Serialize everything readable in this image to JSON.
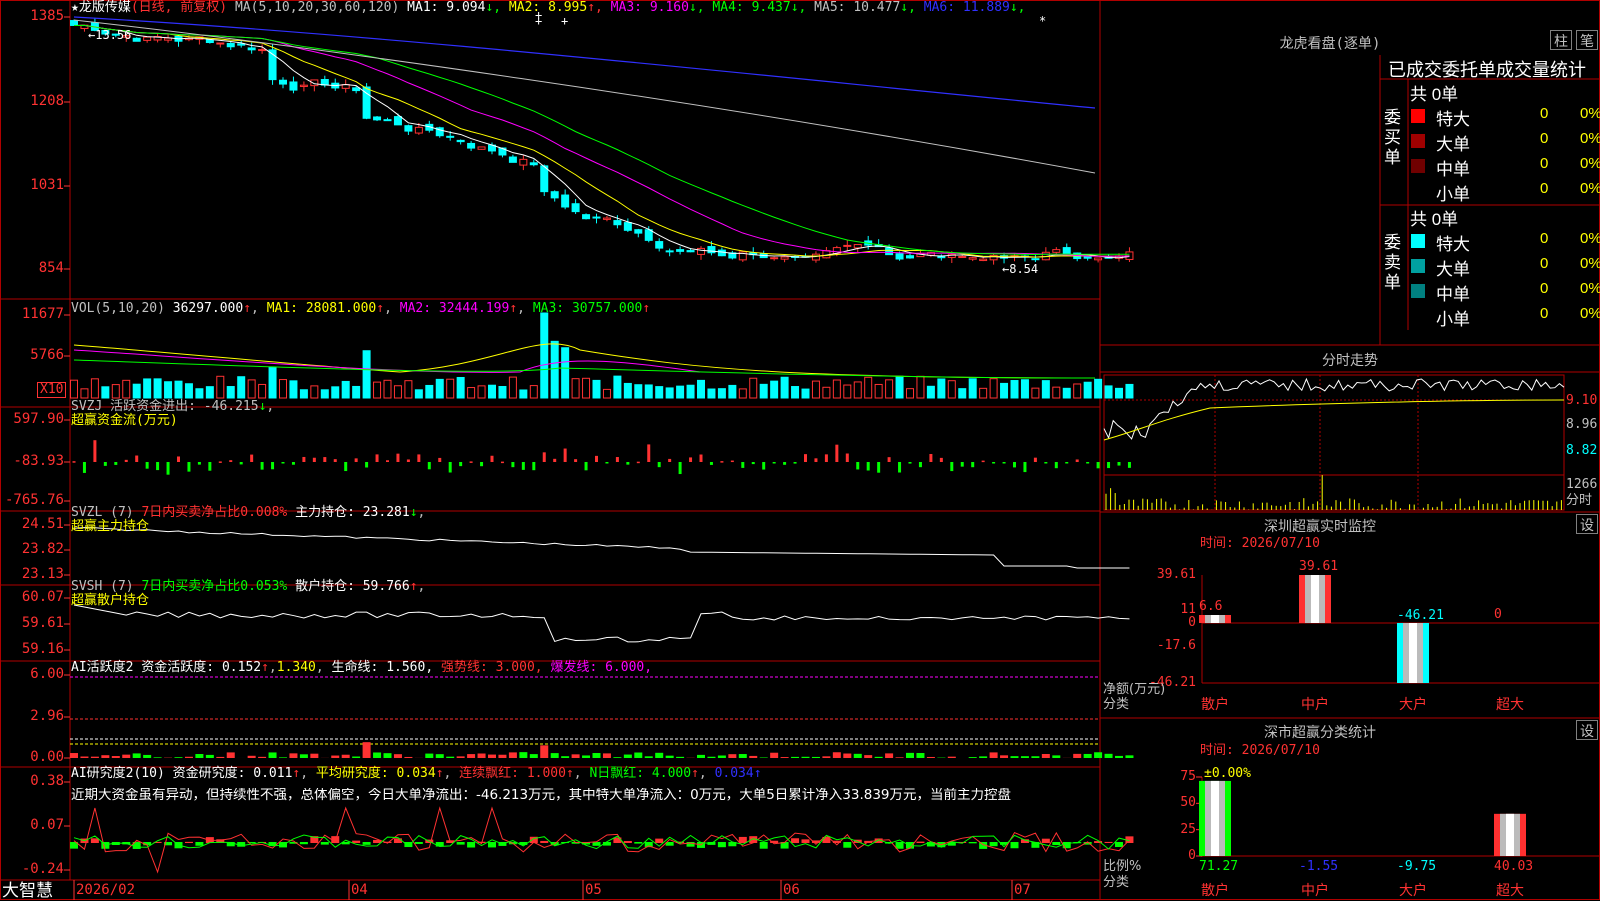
{
  "main": {
    "title": "★龙版传媒",
    "period": "(日线, 前复权)",
    "ma_label": "MA(5,10,20,30,60,120)",
    "ma": [
      {
        "label": "MA1:",
        "value": "9.094",
        "arrow": "↓",
        "color": "#ffffff"
      },
      {
        "label": "MA2:",
        "value": "8.995",
        "arrow": "↑",
        "color": "#ffff00"
      },
      {
        "label": "MA3:",
        "value": "9.160",
        "arrow": "↓",
        "color": "#ff00ff"
      },
      {
        "label": "MA4:",
        "value": "9.437",
        "arrow": "↓",
        "color": "#00ff00"
      },
      {
        "label": "MA5:",
        "value": "10.477",
        "arrow": "↓",
        "color": "#c0c0c0"
      },
      {
        "label": "MA6:",
        "value": "11.889",
        "arrow": "↓",
        "color": "#3030ff"
      }
    ],
    "y_ticks": [
      "1385",
      "1208",
      "1031",
      "854"
    ],
    "high_label": "13.56",
    "low_label": "8.54"
  },
  "vol": {
    "label": "VOL(5,10,20)",
    "value": "36297.000",
    "ma1": "MA1: 28081.000",
    "ma2": "MA2: 32444.199",
    "ma3": "MA3: 30757.000",
    "y_ticks": [
      "11677",
      "5766"
    ],
    "unit": "X10"
  },
  "svzj": {
    "label": "SVZJ  活跃资金进出: -46.215",
    "sub": "超赢资金流(万元)",
    "y_ticks": [
      "597.90",
      "-83.93",
      "-765.76"
    ]
  },
  "svzl": {
    "label": "SVZL (7)",
    "ratio": "7日内买卖净占比0.008%",
    "hold": "主力持仓: 23.281",
    "sub": "超赢主力持仓",
    "y_ticks": [
      "24.51",
      "23.82",
      "23.13"
    ]
  },
  "svsh": {
    "label": "SVSH (7)",
    "ratio": "7日内买卖净占比0.053%",
    "hold": "散户持仓: 59.766",
    "sub": "超赢散户持仓",
    "y_ticks": [
      "60.07",
      "59.61",
      "59.16"
    ]
  },
  "ai1": {
    "label": "AI活跃度2 资金活跃度: 0.152",
    "v2": "1.340",
    "life": "生命线: 1.560,",
    "strong": "强势线: 3.000,",
    "burst": "爆发线: 6.000,",
    "y_ticks": [
      "6.00",
      "2.96",
      "0.00"
    ]
  },
  "ai2": {
    "label": "AI研究度2(10) 资金研究度: 0.011",
    "avg": "平均研究度: 0.034",
    "cont": "连续飘红: 1.000",
    "nday": "N日飘红: 4.000",
    "last": "0.034",
    "comment": "近期大资金虽有异动，但持续性不强，总体偏空，今日大单净流出：-46.213万元，其中特大单净流入：0万元，大单5日累计净入33.839万元，当前主力控盘",
    "y_ticks": [
      "0.38",
      "0.07",
      "-0.24"
    ]
  },
  "xaxis": {
    "labels": [
      "2026/02",
      "04",
      "05",
      "06",
      "07"
    ],
    "brand": "大智慧"
  },
  "right": {
    "dragon_title": "龙虎看盘(逐单)",
    "btn_zhu": "柱",
    "btn_bi": "笔",
    "stat_title": "已成交委托单成交量统计",
    "buy": {
      "side": "委买单",
      "total": "共 0单",
      "rows": [
        {
          "name": "特大",
          "count": "0",
          "pct": "0%",
          "color": "#ff0000"
        },
        {
          "name": "大单",
          "count": "0",
          "pct": "0%",
          "color": "#a00000"
        },
        {
          "name": "中单",
          "count": "0",
          "pct": "0%",
          "color": "#700000"
        },
        {
          "name": "小单",
          "count": "0",
          "pct": "0%",
          "color": "#000000"
        }
      ]
    },
    "sell": {
      "side": "委卖单",
      "total": "共 0单",
      "rows": [
        {
          "name": "特大",
          "count": "0",
          "pct": "0%",
          "color": "#00ffff"
        },
        {
          "name": "大单",
          "count": "0",
          "pct": "0%",
          "color": "#00a0a0"
        },
        {
          "name": "中单",
          "count": "0",
          "pct": "0%",
          "color": "#008080"
        },
        {
          "name": "小单",
          "count": "0",
          "pct": "0%",
          "color": "#000000"
        }
      ]
    },
    "fenshi_title": "分时走势",
    "fenshi_prices": [
      "9.10",
      "8.96",
      "8.82"
    ],
    "fenshi_vol": "1266",
    "fenshi_unit": "分时",
    "sz_title": "深圳超赢实时监控",
    "sz_btn": "设",
    "sz_time": "时间: 2026/07/10",
    "sz_yticks": [
      "39.61",
      "11",
      "0",
      "-17.6",
      "-46.21"
    ],
    "sz_values": [
      {
        "cat": "散户",
        "label": "6.6",
        "value": 6.6
      },
      {
        "cat": "中户",
        "label": "39.61",
        "value": 39.61
      },
      {
        "cat": "大户",
        "label": "-46.21",
        "value": -46.21
      },
      {
        "cat": "超大",
        "label": "0",
        "value": 0
      }
    ],
    "sz_ylabel": "净额(万元)",
    "sz_xlabel": "分类",
    "cls_title": "深市超赢分类统计",
    "cls_btn": "设",
    "cls_time": "时间: 2026/07/10",
    "cls_yticks": [
      "75",
      "50",
      "25",
      "0"
    ],
    "cls_top": "±0.00%",
    "cls_values": [
      {
        "cat": "散户",
        "label": "71.27",
        "value": 71.27,
        "color": "#00ff00"
      },
      {
        "cat": "中户",
        "label": "-1.55",
        "value": -1.55,
        "color": "#3030ff"
      },
      {
        "cat": "大户",
        "label": "-9.75",
        "value": -9.75,
        "color": "#00ffff"
      },
      {
        "cat": "超大",
        "label": "40.03",
        "value": 40.03,
        "color": "#ff3030"
      }
    ],
    "cls_ylabel": "比例%",
    "cls_xlabel": "分类"
  }
}
